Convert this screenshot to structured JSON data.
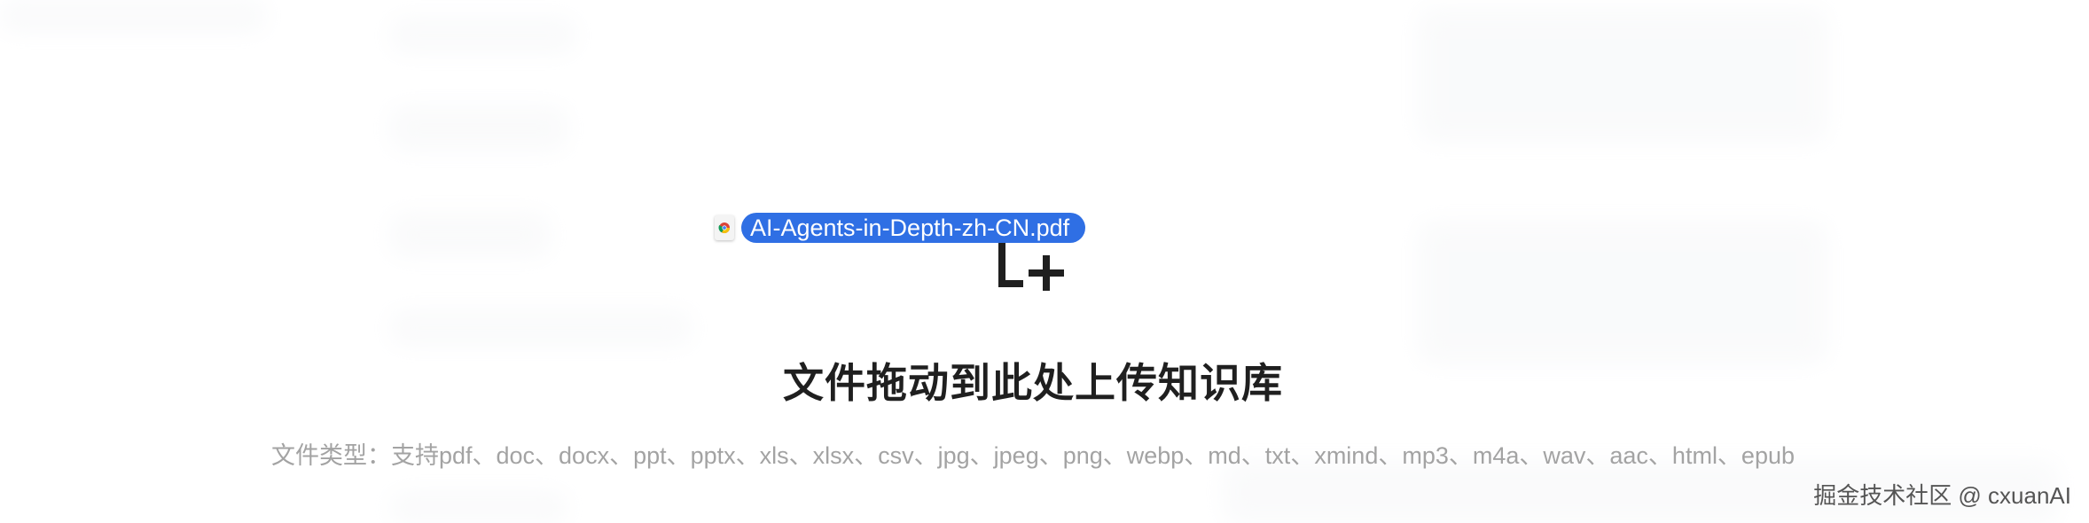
{
  "drag": {
    "file_name": "AI-Agents-in-Depth-zh-CN.pdf",
    "thumb_icon": "chrome-file-icon"
  },
  "dropzone": {
    "icon": "upload-plus-icon",
    "title": "文件拖动到此处上传知识库",
    "file_types_text": "文件类型：支持pdf、doc、docx、ppt、pptx、xls、xlsx、csv、jpg、jpeg、png、webp、md、txt、xmind、mp3、m4a、wav、aac、html、epub"
  },
  "watermark": {
    "text": "掘金技术社区 @ cxuanAI"
  },
  "colors": {
    "accent": "#2f6fe4",
    "title": "#1f1f1f",
    "muted": "#a3a3a3"
  }
}
